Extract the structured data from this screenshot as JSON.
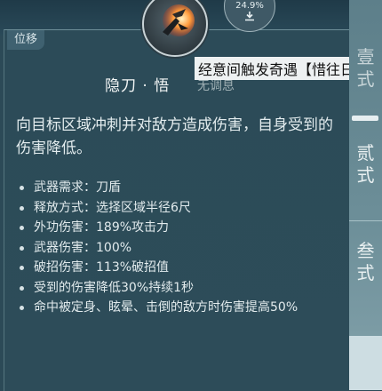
{
  "tag": "位移",
  "skill": {
    "name": "隐刀 · 悟",
    "sub": "无调息",
    "download_percent": "24.9%"
  },
  "overlay_title": "经意间触发奇遇【惜往日】",
  "description": "向目标区域冲刺并对敌方造成伤害，自身受到的伤害降低。",
  "attributes": [
    "武器需求：刀盾",
    "释放方式：选择区域半径6尺",
    "外功伤害：189%攻击力",
    "武器伤害：100%",
    "破招伤害：113%破招值",
    "受到的伤害降低30%持续1秒",
    "命中被定身、眩晕、击倒的敌方时伤害提高50%"
  ],
  "tabs": [
    "壹式",
    "贰式",
    "叁式"
  ],
  "icons": {
    "skill": "skill-blade-icon",
    "download": "download-icon"
  }
}
